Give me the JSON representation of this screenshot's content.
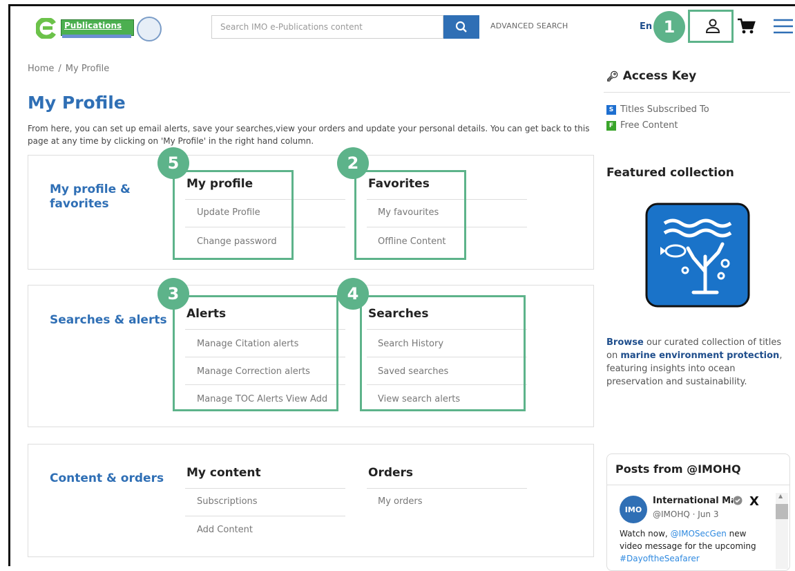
{
  "header": {
    "logo_text": "Publications",
    "search_placeholder": "Search IMO e-Publications content",
    "advanced_search": "ADVANCED SEARCH",
    "language": "En"
  },
  "breadcrumb": {
    "home": "Home",
    "separator": "/",
    "current": "My Profile"
  },
  "page": {
    "title": "My Profile",
    "intro": "From here, you can set up email alerts, save your searches,view your orders and update your personal details. You can get back to this page at any time by clicking on 'My Profile' in the right hand column."
  },
  "sections": {
    "profile": {
      "title": "My profile & favorites",
      "col1": {
        "heading": "My profile",
        "links": [
          "Update Profile",
          "Change password"
        ]
      },
      "col2": {
        "heading": "Favorites",
        "links": [
          "My favourites",
          "Offline Content"
        ]
      }
    },
    "searches": {
      "title": "Searches & alerts",
      "col1": {
        "heading": "Alerts",
        "links": [
          "Manage Citation alerts",
          "Manage Correction alerts",
          "Manage TOC Alerts View Add"
        ]
      },
      "col2": {
        "heading": "Searches",
        "links": [
          "Search History",
          "Saved searches",
          "View search alerts"
        ]
      }
    },
    "content": {
      "title": "Content & orders",
      "col1": {
        "heading": "My content",
        "links": [
          "Subscriptions",
          "Add Content"
        ]
      },
      "col2": {
        "heading": "Orders",
        "links": [
          "My orders"
        ]
      }
    }
  },
  "callouts": [
    "1",
    "2",
    "3",
    "4",
    "5"
  ],
  "access_key": {
    "title": "Access Key",
    "items": [
      {
        "badge": "S",
        "label": "Titles Subscribed To",
        "color": "#1e6fd0"
      },
      {
        "badge": "F",
        "label": "Free Content",
        "color": "#3aa52b"
      }
    ]
  },
  "featured": {
    "title": "Featured collection",
    "text_browse": "Browse",
    "text_part1": " our curated collection of titles on ",
    "text_bold": "marine environment protection",
    "text_part2": ", featuring insights into ocean preservation and sustainability."
  },
  "posts": {
    "title": "Posts from @IMOHQ",
    "logo": "IMO",
    "name": "International Ma",
    "handle": "@IMOHQ · Jun 3",
    "text_a": "Watch now, ",
    "mention": "@IMOSecGen",
    "text_b": " new video message for the upcoming ",
    "hashtag": "#DayoftheSeafarer"
  },
  "colors": {
    "accent": "#2f6fb5",
    "highlight": "#5db38a",
    "brand_green": "#4caf50"
  }
}
